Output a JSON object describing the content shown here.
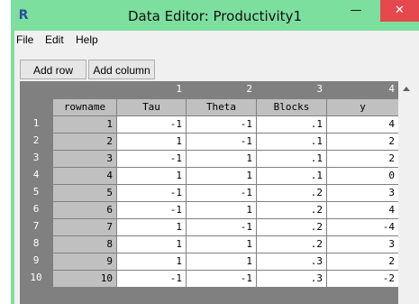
{
  "window": {
    "title": "Data Editor: Productivity1",
    "icon": "r-logo-icon"
  },
  "controls": {
    "minimize": "—",
    "close": "✕"
  },
  "menu": [
    "File",
    "Edit",
    "Help"
  ],
  "toolbar": {
    "add_row": "Add row",
    "add_column": "Add column"
  },
  "grid": {
    "col_numbers": [
      "1",
      "2",
      "3",
      "4"
    ],
    "col_names": [
      "rowname",
      "Tau",
      "Theta",
      "Blocks",
      "y"
    ],
    "rows": [
      {
        "n": "1",
        "rowname": "1",
        "tau": "-1",
        "theta": "-1",
        "blocks": ".1",
        "y": "4"
      },
      {
        "n": "2",
        "rowname": "2",
        "tau": "1",
        "theta": "-1",
        "blocks": ".1",
        "y": "2"
      },
      {
        "n": "3",
        "rowname": "3",
        "tau": "-1",
        "theta": "1",
        "blocks": ".1",
        "y": "2"
      },
      {
        "n": "4",
        "rowname": "4",
        "tau": "1",
        "theta": "1",
        "blocks": ".1",
        "y": "0"
      },
      {
        "n": "5",
        "rowname": "5",
        "tau": "-1",
        "theta": "-1",
        "blocks": ".2",
        "y": "3"
      },
      {
        "n": "6",
        "rowname": "6",
        "tau": "-1",
        "theta": "1",
        "blocks": ".2",
        "y": "4"
      },
      {
        "n": "7",
        "rowname": "7",
        "tau": "1",
        "theta": "-1",
        "blocks": ".2",
        "y": "-4"
      },
      {
        "n": "8",
        "rowname": "8",
        "tau": "1",
        "theta": "1",
        "blocks": ".2",
        "y": "3"
      },
      {
        "n": "9",
        "rowname": "9",
        "tau": "1",
        "theta": "1",
        "blocks": ".3",
        "y": "2"
      },
      {
        "n": "10",
        "rowname": "10",
        "tau": "-1",
        "theta": "-1",
        "blocks": ".3",
        "y": "-2"
      }
    ]
  }
}
